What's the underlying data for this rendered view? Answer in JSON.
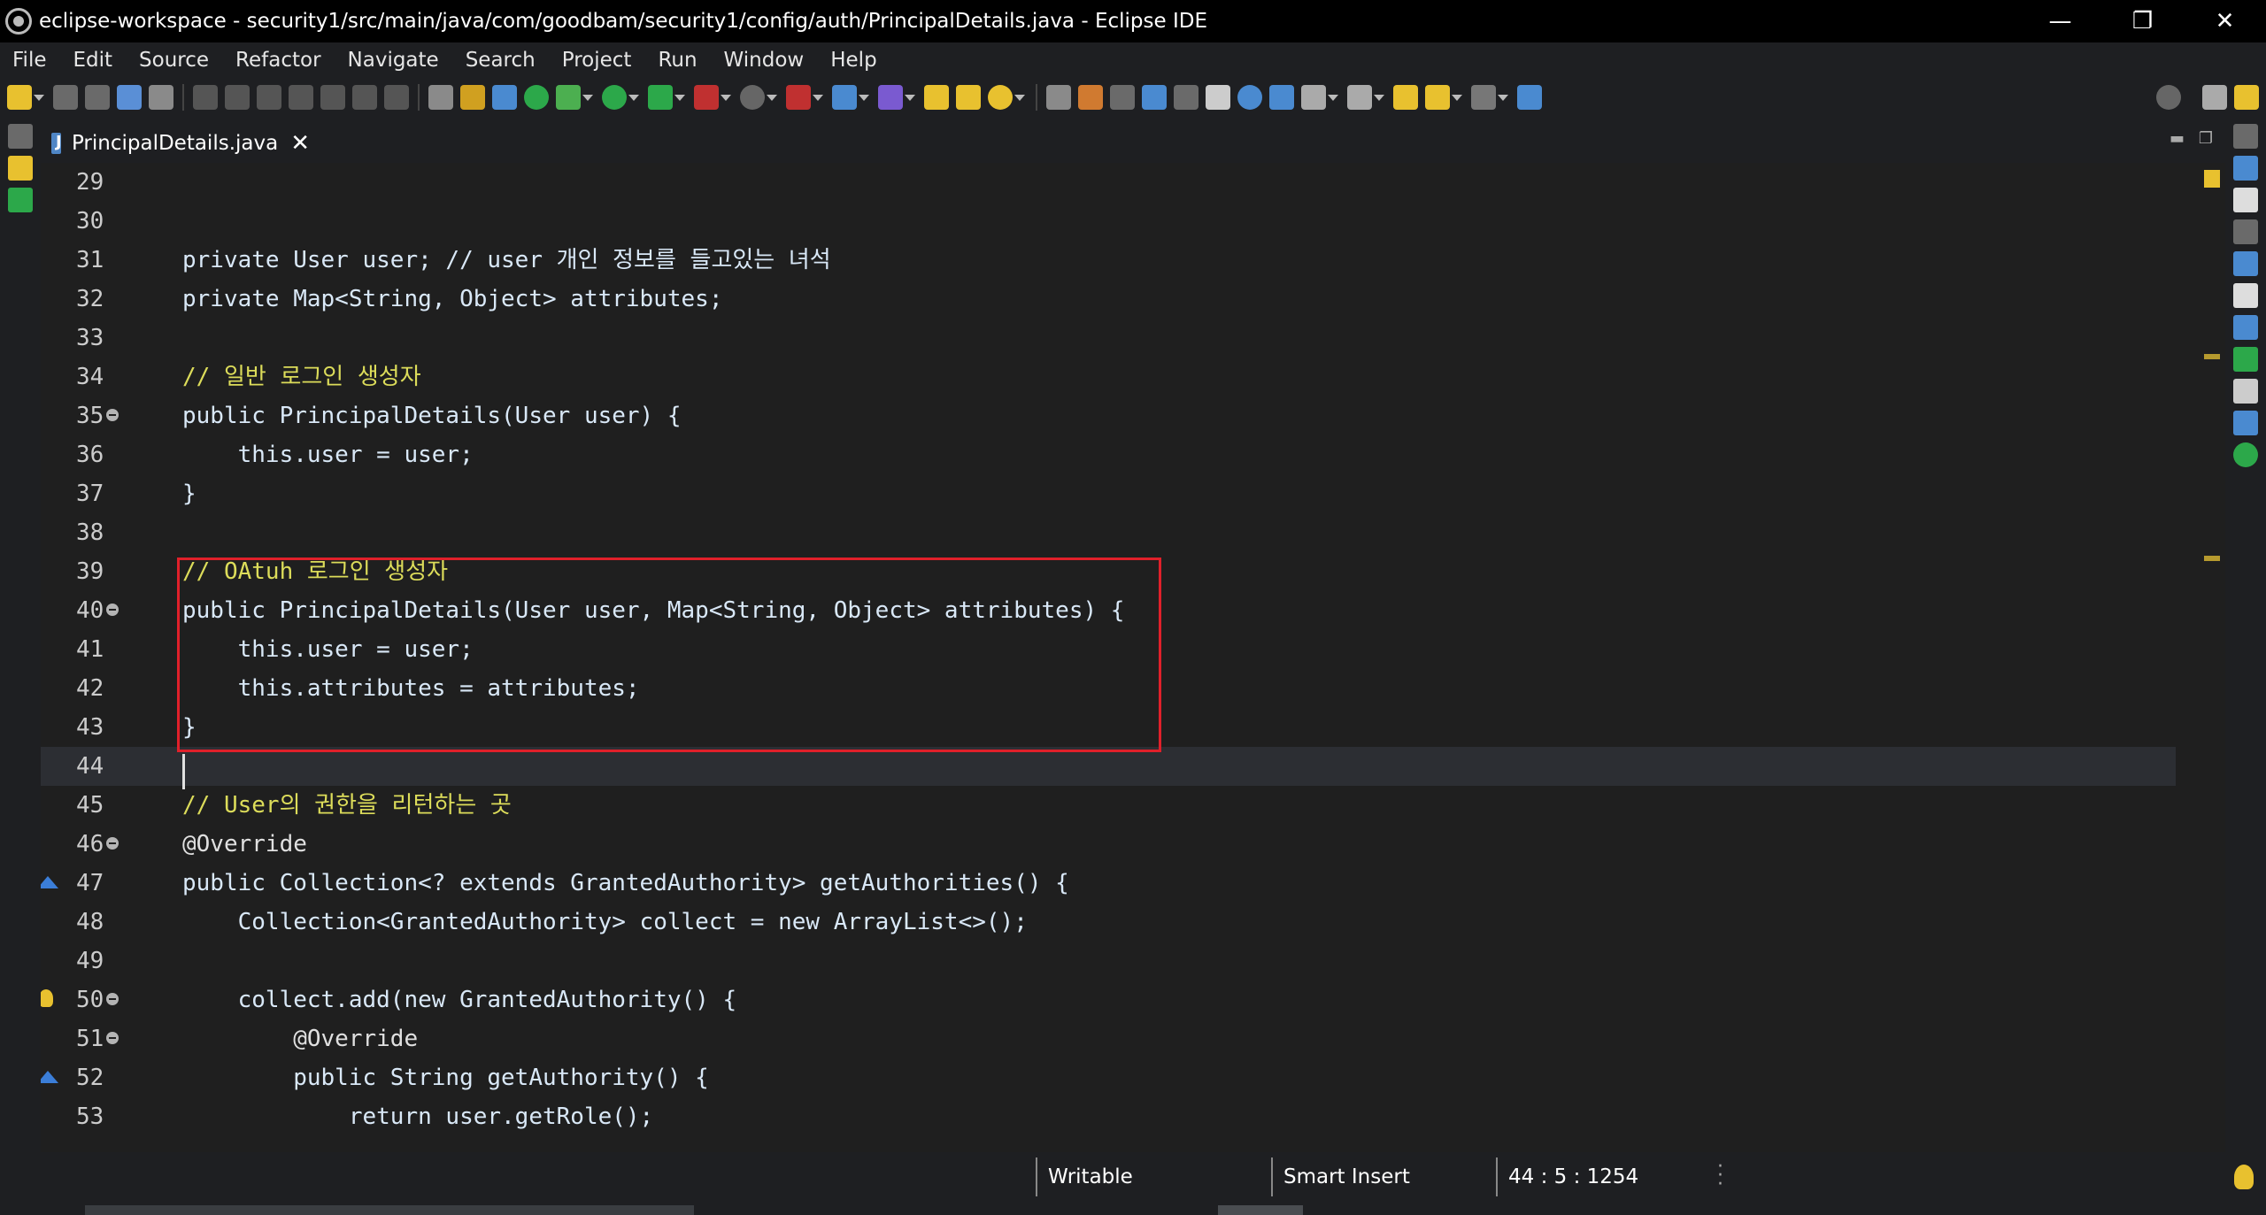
{
  "window": {
    "title": "eclipse-workspace - security1/src/main/java/com/goodbam/security1/config/auth/PrincipalDetails.java - Eclipse IDE",
    "controls": {
      "minimize": "—",
      "restore": "❐",
      "close": "✕"
    }
  },
  "menu": [
    "File",
    "Edit",
    "Source",
    "Refactor",
    "Navigate",
    "Search",
    "Project",
    "Run",
    "Window",
    "Help"
  ],
  "editor_tab": {
    "label": "PrincipalDetails.java",
    "close": "✕"
  },
  "lines": [
    {
      "n": "29",
      "code": ""
    },
    {
      "n": "30",
      "code": ""
    },
    {
      "n": "31",
      "code": "private User user; // user 개인 정보를 들고있는 녀석"
    },
    {
      "n": "32",
      "code": "private Map<String, Object> attributes;"
    },
    {
      "n": "33",
      "code": ""
    },
    {
      "n": "34",
      "code": "// 일반 로그인 생성자"
    },
    {
      "n": "35",
      "code": "public PrincipalDetails(User user) {"
    },
    {
      "n": "36",
      "code": "    this.user = user;"
    },
    {
      "n": "37",
      "code": "}"
    },
    {
      "n": "38",
      "code": ""
    },
    {
      "n": "39",
      "code": "// OAtuh 로그인 생성자"
    },
    {
      "n": "40",
      "code": "public PrincipalDetails(User user, Map<String, Object> attributes) {"
    },
    {
      "n": "41",
      "code": "    this.user = user;"
    },
    {
      "n": "42",
      "code": "    this.attributes = attributes;"
    },
    {
      "n": "43",
      "code": "}"
    },
    {
      "n": "44",
      "code": ""
    },
    {
      "n": "45",
      "code": "// User의 권한을 리턴하는 곳"
    },
    {
      "n": "46",
      "code": "@Override"
    },
    {
      "n": "47",
      "code": "public Collection<? extends GrantedAuthority> getAuthorities() {"
    },
    {
      "n": "48",
      "code": "    Collection<GrantedAuthority> collect = new ArrayList<>();"
    },
    {
      "n": "49",
      "code": ""
    },
    {
      "n": "50",
      "code": "    collect.add(new GrantedAuthority() {"
    },
    {
      "n": "51",
      "code": "        @Override"
    },
    {
      "n": "52",
      "code": "        public String getAuthority() {"
    },
    {
      "n": "53",
      "code": "            return user.getRole();"
    }
  ],
  "status": {
    "writable": "Writable",
    "insert_mode": "Smart Insert",
    "position": "44 : 5 : 1254"
  },
  "colors": {
    "highlight_box": "#e0202a",
    "background": "#1f1f1f",
    "comment": "#dcdc5a",
    "keyword": "#9cdcfe"
  }
}
